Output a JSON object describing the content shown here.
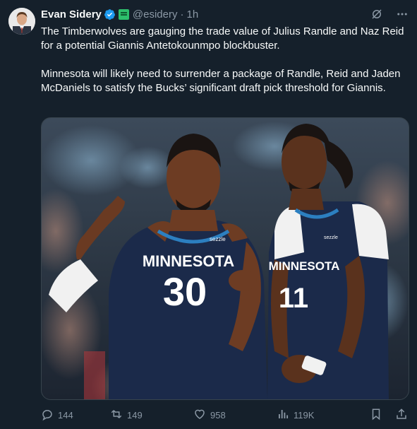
{
  "author": {
    "name": "Evan Sidery",
    "handle": "@esidery",
    "separator": "·",
    "time": "1h",
    "verified": true,
    "affiliate_badge": "green-affiliation-badge"
  },
  "tweet": {
    "paragraph1": "The Timberwolves are gauging the trade value of Julius Randle and Naz Reid for a potential Giannis Antetokounmpo blockbuster.",
    "paragraph2": "Minnesota will likely need to surrender a package of Randle, Reid and Jaden McDaniels to satisfy the Bucks’ significant draft pick threshold for Giannis."
  },
  "media": {
    "jersey_left": {
      "team": "MINNESOTA",
      "number": "30"
    },
    "jersey_right": {
      "team": "MINNESOTA",
      "number": "11"
    },
    "sponsor": "sezzle"
  },
  "actions": {
    "replies": "144",
    "retweets": "149",
    "likes": "958",
    "views": "119K"
  },
  "colors": {
    "background": "#15202b",
    "text": "#f7f9f9",
    "muted": "#8b98a5",
    "verified_blue": "#1d9bf0",
    "jersey_navy": "#1b2a4a"
  }
}
